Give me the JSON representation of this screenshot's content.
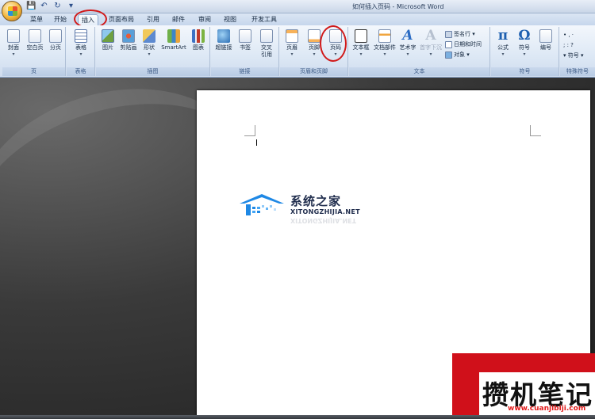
{
  "window": {
    "title": "如何插入页码 - Microsoft Word"
  },
  "quick_access": [
    {
      "icon": "save-icon",
      "glyph": "💾"
    },
    {
      "icon": "undo-icon",
      "glyph": "↶"
    },
    {
      "icon": "redo-icon",
      "glyph": "↻"
    },
    {
      "icon": "customize-icon",
      "glyph": "▾"
    }
  ],
  "tabs": [
    {
      "label": "菜单"
    },
    {
      "label": "开始"
    },
    {
      "label": "插入",
      "active": true
    },
    {
      "label": "页面布局"
    },
    {
      "label": "引用"
    },
    {
      "label": "邮件"
    },
    {
      "label": "审阅"
    },
    {
      "label": "视图"
    },
    {
      "label": "开发工具"
    }
  ],
  "ribbon": {
    "groups": [
      {
        "label": "页",
        "buttons": [
          {
            "label": "封面",
            "arrow": "▾",
            "icon": "cover-page-icon"
          },
          {
            "label": "空白页",
            "icon": "blank-page-icon"
          },
          {
            "label": "分页",
            "icon": "page-break-icon"
          }
        ]
      },
      {
        "label": "表格",
        "buttons": [
          {
            "label": "表格",
            "arrow": "▾",
            "icon": "table-icon"
          }
        ]
      },
      {
        "label": "插图",
        "buttons": [
          {
            "label": "图片",
            "icon": "picture-icon"
          },
          {
            "label": "剪贴画",
            "icon": "clip-art-icon"
          },
          {
            "label": "形状",
            "arrow": "▾",
            "icon": "shapes-icon"
          },
          {
            "label": "SmartArt",
            "icon": "smartart-icon"
          },
          {
            "label": "图表",
            "icon": "chart-icon"
          }
        ]
      },
      {
        "label": "链接",
        "buttons": [
          {
            "label": "超链接",
            "icon": "hyperlink-icon"
          },
          {
            "label": "书签",
            "icon": "bookmark-icon"
          },
          {
            "label": "交叉",
            "label2": "引用",
            "icon": "cross-reference-icon"
          }
        ]
      },
      {
        "label": "页眉和页脚",
        "buttons": [
          {
            "label": "页眉",
            "arrow": "▾",
            "icon": "header-icon"
          },
          {
            "label": "页脚",
            "arrow": "▾",
            "icon": "footer-icon"
          },
          {
            "label": "页码",
            "arrow": "▾",
            "icon": "page-number-icon"
          }
        ]
      },
      {
        "label": "文本",
        "buttons": [
          {
            "label": "文本框",
            "arrow": "▾",
            "icon": "text-box-icon"
          },
          {
            "label": "文档部件",
            "arrow": "▾",
            "icon": "quick-parts-icon"
          },
          {
            "label": "艺术字",
            "arrow": "▾",
            "icon": "wordart-icon"
          },
          {
            "label": "首字下沉",
            "arrow": "▾",
            "icon": "drop-cap-icon"
          }
        ],
        "small_buttons": [
          {
            "label": "签名行 ▾",
            "icon": "signature-line-icon"
          },
          {
            "label": "日期和时间",
            "icon": "date-time-icon"
          },
          {
            "label": "对象 ▾",
            "icon": "object-icon"
          }
        ]
      },
      {
        "label": "符号",
        "buttons": [
          {
            "label": "公式",
            "arrow": "▾",
            "icon": "equation-icon",
            "glyph": "π"
          },
          {
            "label": "符号",
            "arrow": "▾",
            "icon": "symbol-icon",
            "glyph": "Ω"
          },
          {
            "label": "编号",
            "icon": "number-icon"
          }
        ]
      },
      {
        "label": "特殊符号",
        "small_buttons": [
          {
            "label": "•  ,  ·",
            "icon": "special-symbols-icon"
          },
          {
            "label": ";  :  ?",
            "icon": "special-symbols-icon"
          },
          {
            "label": "▾ 符号 ▾",
            "icon": "special-symbols-more-icon"
          }
        ]
      }
    ]
  },
  "document": {
    "watermark": {
      "title": "系统之家",
      "subtitle": "XITONGZHIJIA.NET",
      "mirror": "XITONGZHIJIA.NET"
    }
  },
  "stamp": {
    "title": "攒机笔记",
    "url": "www.cuanjibiji.com"
  },
  "colors": {
    "annotation": "#d11a1a",
    "ribbon": "#dde8f5",
    "stamp_red": "#d0101a"
  }
}
